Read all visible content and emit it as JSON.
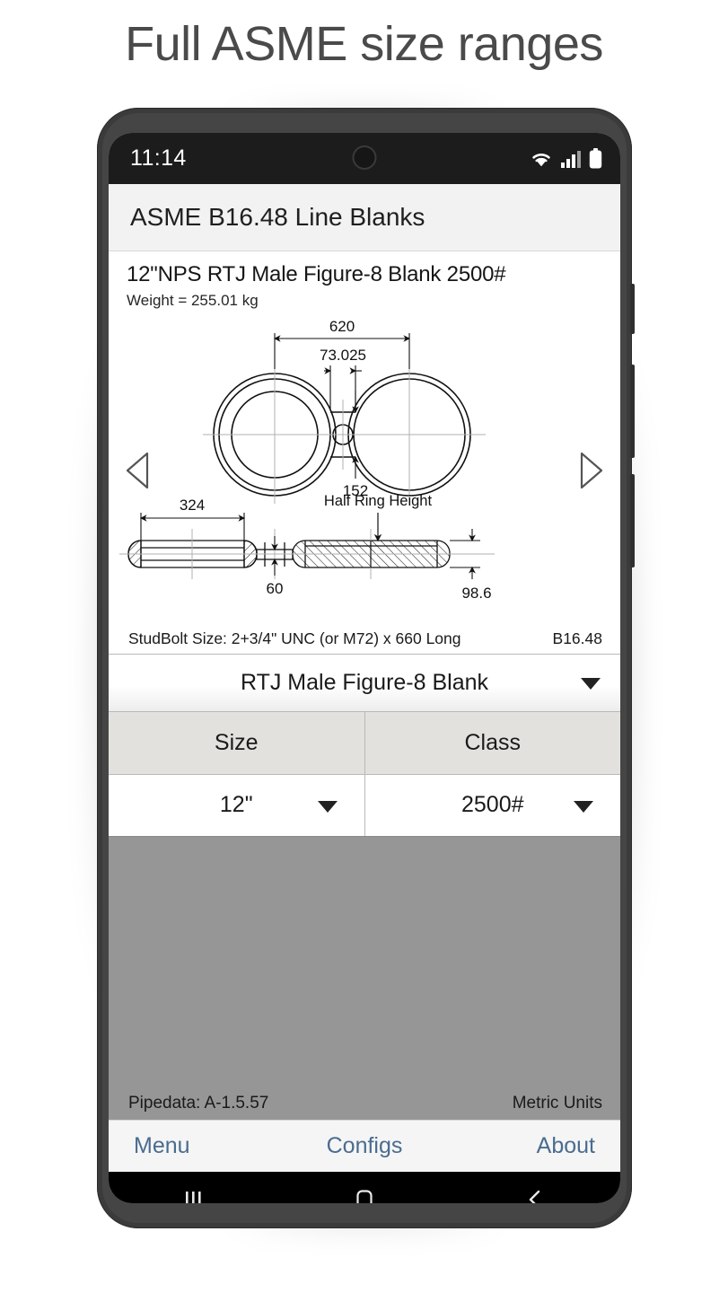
{
  "banner": {
    "title": "Full ASME size ranges"
  },
  "status_bar": {
    "time": "11:14",
    "icons": [
      "wifi-icon",
      "cellular-signal-icon",
      "battery-icon"
    ],
    "signal_bars_filled": 3,
    "signal_bars_total": 4
  },
  "app": {
    "header_title": "ASME B16.48 Line Blanks",
    "item_title": "12\"NPS RTJ Male Figure-8 Blank 2500#",
    "weight_label": "Weight =  255.01 kg"
  },
  "drawing": {
    "dim_width_overall": "620",
    "dim_web_width": "73.025",
    "dim_web_height": "152",
    "dim_bore": "324",
    "dim_web_thickness": "60",
    "dim_ring_height": "98.6",
    "annotation_half_ring": "Half Ring Height",
    "prev_label": "prev-item-arrow",
    "next_label": "next-item-arrow"
  },
  "studbolt": {
    "text": "StudBolt Size: 2+3/4\" UNC  (or M72)  x 660 Long",
    "standard": "B16.48"
  },
  "type_select": {
    "value": "RTJ Male Figure-8 Blank"
  },
  "table": {
    "headers": [
      "Size",
      "Class"
    ],
    "row": [
      "12\"",
      "2500#"
    ]
  },
  "footer": {
    "pipedata": "Pipedata: A-1.5.57",
    "units": "Metric Units"
  },
  "tabs": [
    {
      "label": "Menu"
    },
    {
      "label": "Configs"
    },
    {
      "label": "About"
    }
  ],
  "android_nav": {
    "recents": "recents-icon",
    "home": "home-icon",
    "back": "back-icon"
  },
  "colors": {
    "accent_link": "#4a6c8f",
    "gray_body": "#969696",
    "header_bg": "#f2f2f2",
    "table_header_bg": "#e3e1de",
    "phone_frame": "#3b3b3b"
  }
}
